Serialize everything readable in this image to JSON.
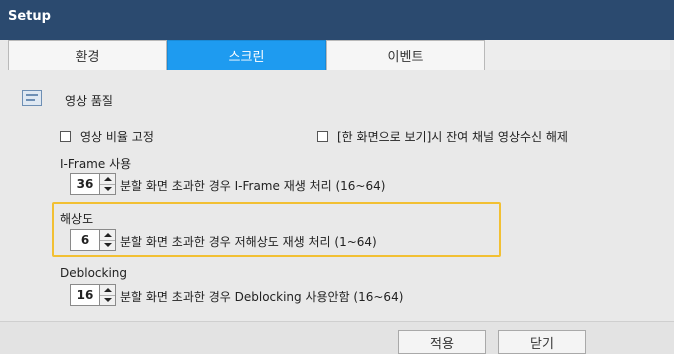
{
  "window": {
    "title": "Setup"
  },
  "tabs": [
    {
      "label": "환경"
    },
    {
      "label": "스크린"
    },
    {
      "label": "이벤트"
    }
  ],
  "section": {
    "title": "영상 품질"
  },
  "options": {
    "fix_ratio": "영상 비율 고정",
    "disable_residual": "[한 화면으로 보기]시 잔여 채널 영상수신 해제"
  },
  "iframe": {
    "label": "I-Frame 사용",
    "value": "36",
    "desc": "분할 화면 초과한 경우 I-Frame 재생 처리 (16~64)"
  },
  "resolution": {
    "label": "해상도",
    "value": "6",
    "desc": "분할 화면 초과한 경우 저해상도 재생 처리 (1~64)"
  },
  "deblocking": {
    "label": "Deblocking",
    "value": "16",
    "desc": "분할 화면 초과한 경우 Deblocking 사용안함 (16~64)"
  },
  "footer": {
    "apply": "적용",
    "close": "닫기"
  },
  "colors": {
    "titlebar": "#2b4a6f",
    "active_tab": "#1e9bf0",
    "highlight": "#f2c033"
  }
}
